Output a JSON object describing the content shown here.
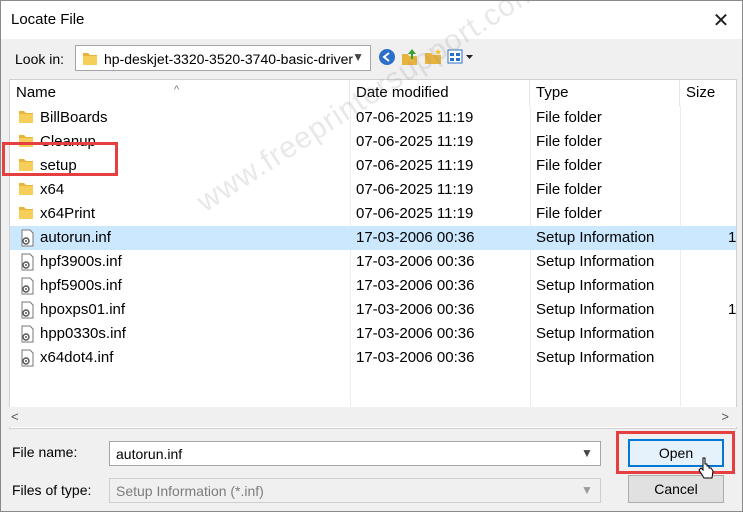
{
  "window": {
    "title": "Locate File",
    "close_glyph": "✕"
  },
  "lookin": {
    "label": "Look in:",
    "value": "hp-deskjet-3320-3520-3740-basic-driver"
  },
  "toolbar": {
    "icons": [
      "back-icon",
      "up-folder-icon",
      "new-folder-icon",
      "view-menu-icon"
    ]
  },
  "columns": [
    "Name",
    "Date modified",
    "Type",
    "Size"
  ],
  "files": [
    {
      "name": "BillBoards",
      "date": "07-06-2025 11:19",
      "type": "File folder",
      "size": "",
      "icon": "folder-icon"
    },
    {
      "name": "Cleanup",
      "date": "07-06-2025 11:19",
      "type": "File folder",
      "size": "",
      "icon": "folder-icon"
    },
    {
      "name": "setup",
      "date": "07-06-2025 11:19",
      "type": "File folder",
      "size": "",
      "icon": "folder-icon"
    },
    {
      "name": "x64",
      "date": "07-06-2025 11:19",
      "type": "File folder",
      "size": "",
      "icon": "folder-icon"
    },
    {
      "name": "x64Print",
      "date": "07-06-2025 11:19",
      "type": "File folder",
      "size": "",
      "icon": "folder-icon"
    },
    {
      "name": "autorun.inf",
      "date": "17-03-2006 00:36",
      "type": "Setup Information",
      "size": "1",
      "icon": "setup-file-icon",
      "selected": true
    },
    {
      "name": "hpf3900s.inf",
      "date": "17-03-2006 00:36",
      "type": "Setup Information",
      "size": "",
      "icon": "setup-file-icon"
    },
    {
      "name": "hpf5900s.inf",
      "date": "17-03-2006 00:36",
      "type": "Setup Information",
      "size": "",
      "icon": "setup-file-icon"
    },
    {
      "name": "hpoxps01.inf",
      "date": "17-03-2006 00:36",
      "type": "Setup Information",
      "size": "1",
      "icon": "setup-file-icon"
    },
    {
      "name": "hpp0330s.inf",
      "date": "17-03-2006 00:36",
      "type": "Setup Information",
      "size": "",
      "icon": "setup-file-icon"
    },
    {
      "name": "x64dot4.inf",
      "date": "17-03-2006 00:36",
      "type": "Setup Information",
      "size": "",
      "icon": "setup-file-icon"
    }
  ],
  "filename": {
    "label": "File name:",
    "value": "autorun.inf"
  },
  "filetype": {
    "label": "Files of type:",
    "value": "Setup Information (*.inf)"
  },
  "buttons": {
    "open": "Open",
    "cancel": "Cancel"
  },
  "watermark": "www.freeprintersupport.com",
  "colors": {
    "selection": "#cce8ff",
    "highlight_box": "#e63f3f",
    "accent": "#0078d7",
    "folder": "#e8b33a"
  }
}
